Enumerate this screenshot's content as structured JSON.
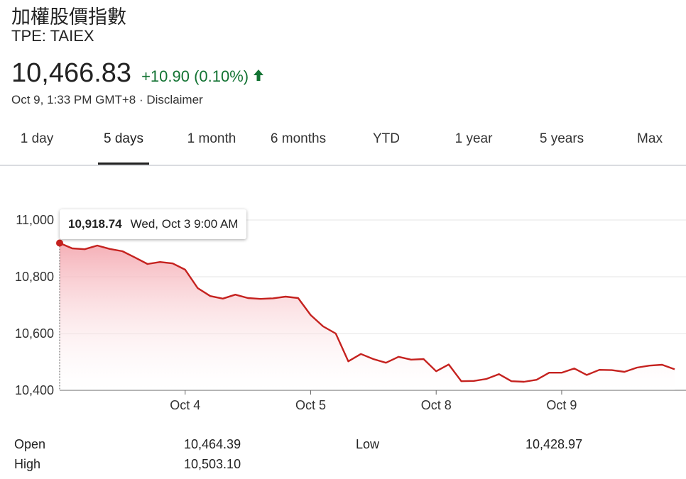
{
  "header": {
    "title": "加權股價指數",
    "ticker": "TPE: TAIEX",
    "price": "10,466.83",
    "change": "+10.90 (0.10%)",
    "timestamp": "Oct 9, 1:33 PM GMT+8 · Disclaimer",
    "change_color": "#137333"
  },
  "tabs": [
    {
      "label": "1 day",
      "active": false
    },
    {
      "label": "5 days",
      "active": true
    },
    {
      "label": "1 month",
      "active": false
    },
    {
      "label": "6 months",
      "active": false
    },
    {
      "label": "YTD",
      "active": false
    },
    {
      "label": "1 year",
      "active": false
    },
    {
      "label": "5 years",
      "active": false
    },
    {
      "label": "Max",
      "active": false
    }
  ],
  "tooltip": {
    "value": "10,918.74",
    "label": "Wed, Oct 3 9:00 AM"
  },
  "stats": {
    "open_label": "Open",
    "open_value": "10,464.39",
    "high_label": "High",
    "high_value": "10,503.10",
    "low_label": "Low",
    "low_value": "10,428.97"
  },
  "chart_data": {
    "type": "area",
    "title": "",
    "xlabel": "",
    "ylabel": "",
    "ylim": [
      10400,
      11000
    ],
    "yticks": [
      "11,000",
      "10,800",
      "10,600",
      "10,400"
    ],
    "ytick_values": [
      11000,
      10800,
      10600,
      10400
    ],
    "xtick_labels": [
      "Oct 4",
      "Oct 5",
      "Oct 8",
      "Oct 9"
    ],
    "xtick_index": [
      10,
      20,
      30,
      40
    ],
    "line_color": "#c5221f",
    "fill_color": "#f4a6ae",
    "grid": true,
    "highlight_index": 0,
    "series": [
      {
        "values": [
          10918.74,
          10900,
          10897,
          10910,
          10898,
          10890,
          10868,
          10845,
          10852,
          10847,
          10825,
          10760,
          10732,
          10723,
          10737,
          10725,
          10722,
          10724,
          10730,
          10725,
          10665,
          10625,
          10600,
          10502,
          10528,
          10510,
          10497,
          10518,
          10508,
          10510,
          10467,
          10491,
          10432,
          10433,
          10440,
          10457,
          10432,
          10430,
          10437,
          10462,
          10462,
          10477,
          10454,
          10472,
          10471,
          10465,
          10480,
          10487,
          10490,
          10474
        ]
      }
    ]
  }
}
